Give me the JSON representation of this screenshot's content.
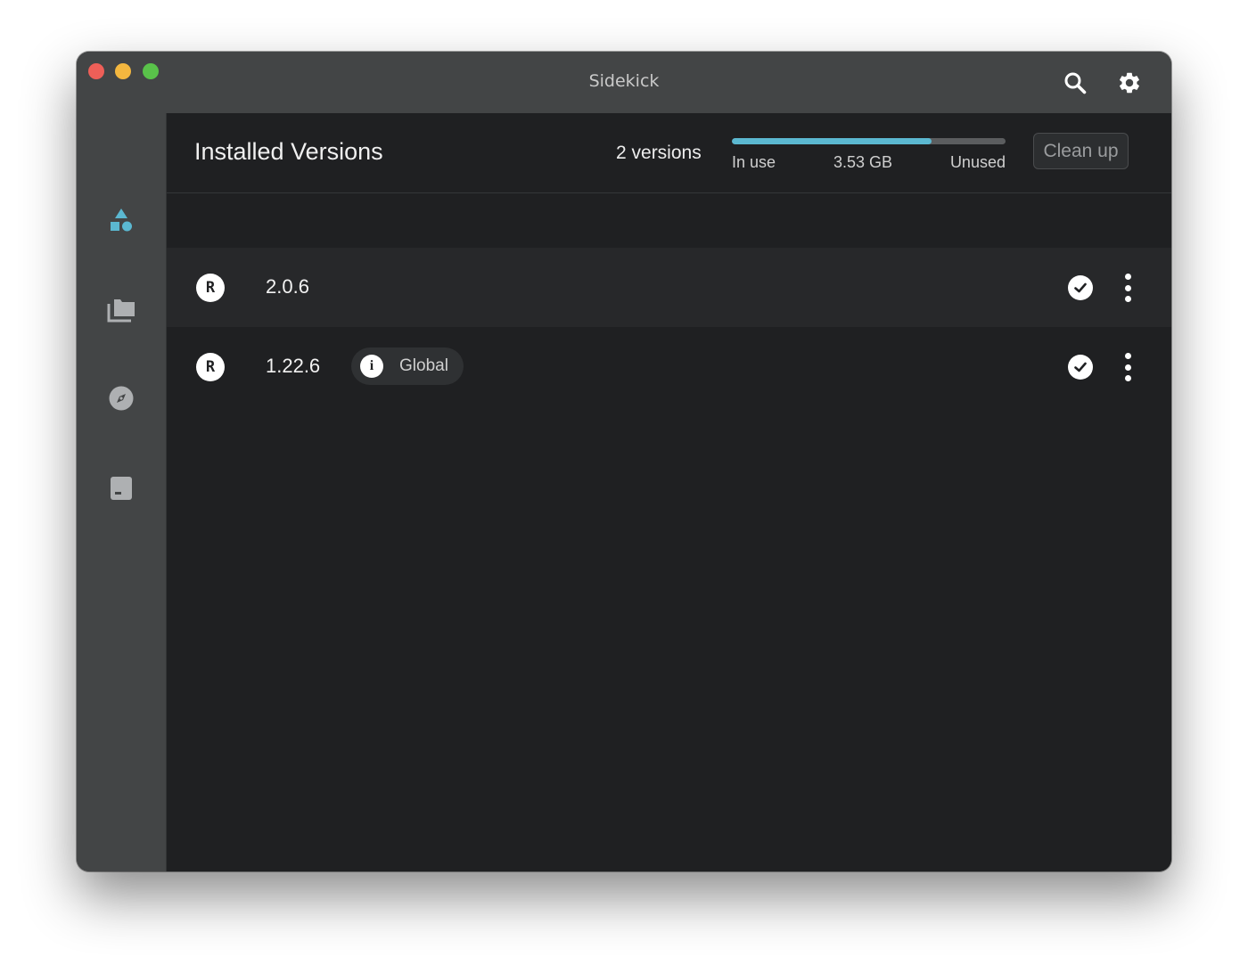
{
  "window": {
    "title": "Sidekick"
  },
  "toolbar": {
    "search_icon": "search-icon",
    "settings_icon": "gear-icon"
  },
  "sidebar": {
    "items": [
      {
        "name": "shapes",
        "icon": "shapes-icon",
        "active": true
      },
      {
        "name": "projects",
        "icon": "folders-icon",
        "active": false
      },
      {
        "name": "explore",
        "icon": "compass-icon",
        "active": false
      },
      {
        "name": "archive",
        "icon": "archive-icon",
        "active": false
      }
    ]
  },
  "header": {
    "title": "Installed Versions",
    "version_count": "2 versions",
    "storage": {
      "in_use_label": "In use",
      "size": "3.53 GB",
      "unused_label": "Unused",
      "in_use_fraction": 0.73
    },
    "cleanup_label": "Clean up"
  },
  "versions": [
    {
      "icon_letter": "R",
      "version": "2.0.6",
      "badge": null,
      "status_icon": "check-circle-icon"
    },
    {
      "icon_letter": "R",
      "version": "1.22.6",
      "badge": {
        "icon": "i",
        "label": "Global"
      },
      "status_icon": "check-circle-icon"
    }
  ],
  "colors": {
    "accent": "#5bb8d1",
    "sidebar_bg": "#434546",
    "main_bg": "#1f2022",
    "row_highlight": "#27282a"
  }
}
